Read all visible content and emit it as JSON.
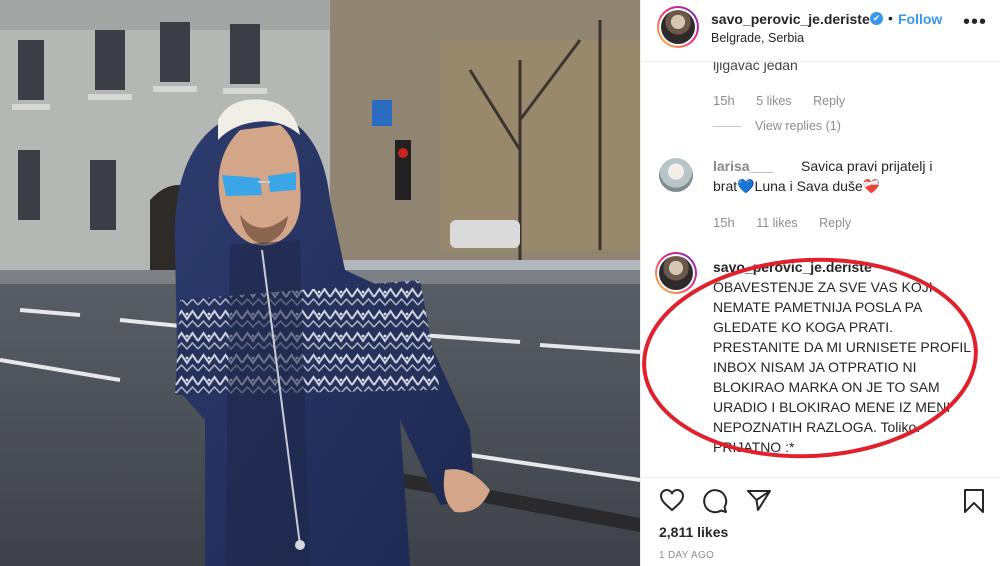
{
  "post": {
    "username": "savo_perovic_je.deriste",
    "verified_mark": "✔",
    "separator": "•",
    "follow_label": "Follow",
    "location": "Belgrade, Serbia",
    "more_label": "•••",
    "likes": "2,811 likes",
    "time_ago": "1 DAY AGO"
  },
  "comments": [
    {
      "text_partial": "ljigavac jedan",
      "time": "15h",
      "likes": "5 likes",
      "reply": "Reply",
      "view_replies": "View replies (1)"
    },
    {
      "username": "larisa___",
      "text_line1": "Savica pravi prijatelj i",
      "text_line2": "brat💙Luna i Sava duše❤️‍🩹",
      "time": "15h",
      "likes": "11 likes",
      "reply": "Reply"
    },
    {
      "username": "savo_perovic_je.deriste",
      "lines": [
        "OBAVESTENJE ZA SVE VAS KOJI",
        "NEMATE PAMETNIJA POSLA PA",
        "GLEDATE KO KOGA PRATI.",
        "PRESTANITE DA MI URNISETE PROFIL I",
        "INBOX NISAM JA OTPRATIO NI",
        "BLOKIRAO MARKA ON JE TO SAM",
        "URADIO I BLOKIRAO MENE IZ MENI",
        "NEPOZNATIH RAZLOGA. Toliko.",
        "PRIJATNO :*"
      ]
    }
  ],
  "colors": {
    "accent": "#3897f0",
    "annotation": "#e0202a",
    "muted": "#8e8e8e"
  },
  "icons": [
    "heart-icon",
    "comment-icon",
    "share-icon",
    "bookmark-icon",
    "verified-icon",
    "more-options-icon"
  ]
}
